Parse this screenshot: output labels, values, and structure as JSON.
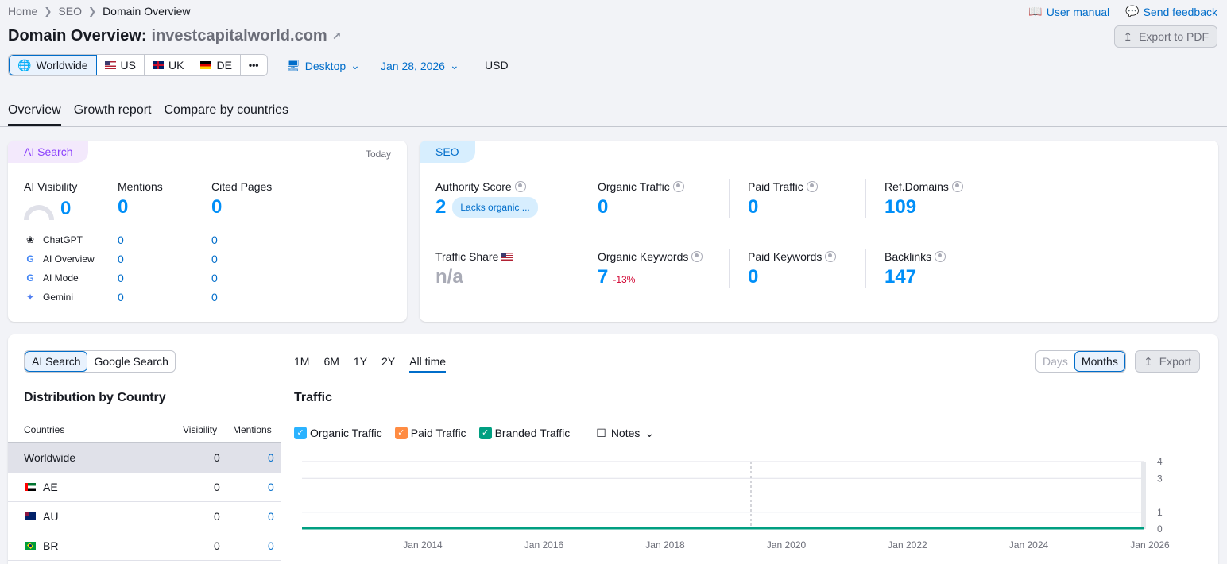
{
  "breadcrumb": [
    "Home",
    "SEO",
    "Domain Overview"
  ],
  "top_links": {
    "user_manual": "User manual",
    "send_feedback": "Send feedback"
  },
  "title": {
    "prefix": "Domain Overview:",
    "domain": "investcapitalworld.com"
  },
  "export_pdf": "Export to PDF",
  "databases": [
    "Worldwide",
    "US",
    "UK",
    "DE"
  ],
  "more": "•••",
  "device": "Desktop",
  "date": "Jan 28, 2026",
  "currency": "USD",
  "tabs": [
    "Overview",
    "Growth report",
    "Compare by countries"
  ],
  "ai_card": {
    "pill": "AI Search",
    "today": "Today",
    "metrics": [
      {
        "label": "AI Visibility",
        "value": "0"
      },
      {
        "label": "Mentions",
        "value": "0"
      },
      {
        "label": "Cited Pages",
        "value": "0"
      }
    ],
    "sources": [
      {
        "name": "ChatGPT",
        "mentions": "0",
        "cited": "0",
        "icon": "chatgpt-icon"
      },
      {
        "name": "AI Overview",
        "mentions": "0",
        "cited": "0",
        "icon": "google-icon"
      },
      {
        "name": "AI Mode",
        "mentions": "0",
        "cited": "0",
        "icon": "google-icon"
      },
      {
        "name": "Gemini",
        "mentions": "0",
        "cited": "0",
        "icon": "gemini-icon"
      }
    ]
  },
  "seo_card": {
    "pill": "SEO",
    "authority": {
      "label": "Authority Score",
      "value": "2",
      "badge": "Lacks organic ..."
    },
    "organic_traffic": {
      "label": "Organic Traffic",
      "value": "0"
    },
    "paid_traffic": {
      "label": "Paid Traffic",
      "value": "0"
    },
    "ref_domains": {
      "label": "Ref.Domains",
      "value": "109"
    },
    "traffic_share": {
      "label": "Traffic Share",
      "value": "n/a"
    },
    "organic_keywords": {
      "label": "Organic Keywords",
      "value": "7",
      "delta": "-13%"
    },
    "paid_keywords": {
      "label": "Paid Keywords",
      "value": "0"
    },
    "backlinks": {
      "label": "Backlinks",
      "value": "147"
    }
  },
  "bottom": {
    "toggle": [
      "AI Search",
      "Google Search"
    ],
    "distribution_title": "Distribution by Country",
    "columns": [
      "Countries",
      "Visibility",
      "Mentions"
    ],
    "rows": [
      {
        "country": "Worldwide",
        "visibility": "0",
        "mentions": "0"
      },
      {
        "country": "AE",
        "visibility": "0",
        "mentions": "0"
      },
      {
        "country": "AU",
        "visibility": "0",
        "mentions": "0"
      },
      {
        "country": "BR",
        "visibility": "0",
        "mentions": "0"
      }
    ],
    "periods": [
      "1M",
      "6M",
      "1Y",
      "2Y",
      "All time"
    ],
    "granularity": [
      "Days",
      "Months"
    ],
    "export": "Export",
    "traffic_title": "Traffic",
    "legend": [
      "Organic Traffic",
      "Paid Traffic",
      "Branded Traffic"
    ],
    "notes": "Notes"
  },
  "chart_data": {
    "type": "line",
    "title": "Traffic",
    "x_ticks": [
      "Jan 2014",
      "Jan 2016",
      "Jan 2018",
      "Jan 2020",
      "Jan 2022",
      "Jan 2024",
      "Jan 2026"
    ],
    "y_ticks": [
      "0",
      "1",
      "3",
      "4"
    ],
    "ylim": [
      0,
      4
    ],
    "series": [
      {
        "name": "Organic Traffic",
        "color": "#009f81",
        "values": [
          0,
          0,
          0,
          0,
          0,
          0,
          0
        ]
      }
    ],
    "grid": true
  },
  "colors": {
    "accent": "#006dca",
    "metric": "#008ff8",
    "organic": "#2bb3ff",
    "paid": "#ff8c43",
    "branded": "#009f81"
  }
}
